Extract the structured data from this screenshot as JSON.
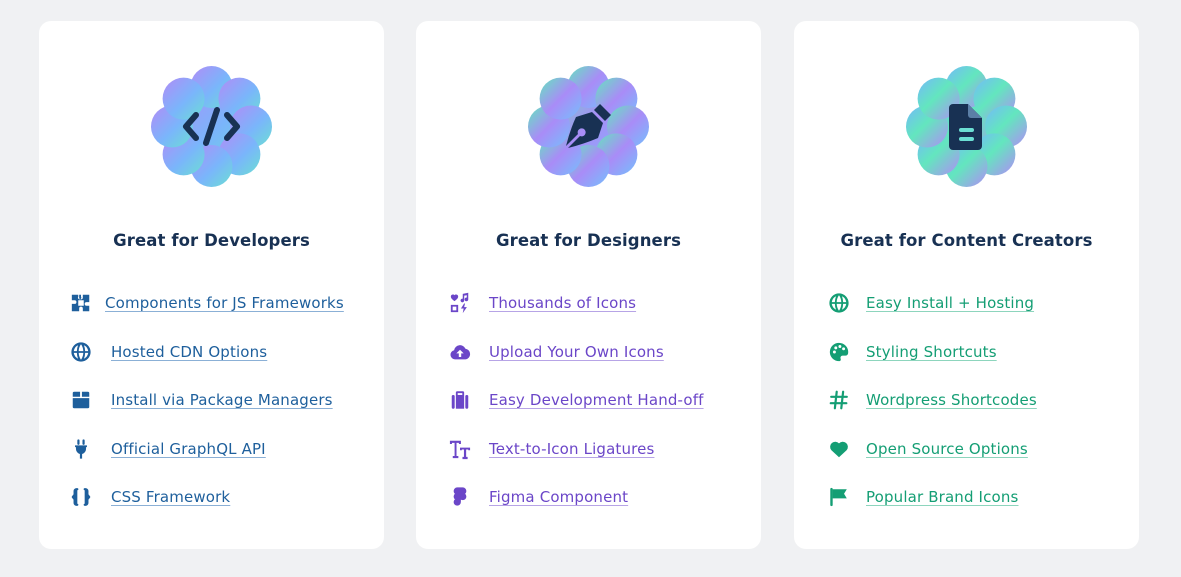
{
  "cards": [
    {
      "title": "Great for Developers",
      "badge_icon": "code-icon",
      "accent": "#1e5f9c",
      "features": [
        {
          "label": "Components for JS Frameworks",
          "icon": "puzzle-pieces-icon"
        },
        {
          "label": "Hosted CDN Options",
          "icon": "globe-icon"
        },
        {
          "label": "Install via Package Managers",
          "icon": "box-icon"
        },
        {
          "label": "Official GraphQL API",
          "icon": "plug-icon"
        },
        {
          "label": "CSS Framework",
          "icon": "curly-braces-icon"
        }
      ]
    },
    {
      "title": "Great for Designers",
      "badge_icon": "pen-nib-icon",
      "accent": "#6b46c8",
      "features": [
        {
          "label": "Thousands of Icons",
          "icon": "icons-collection-icon"
        },
        {
          "label": "Upload Your Own Icons",
          "icon": "cloud-upload-icon"
        },
        {
          "label": "Easy Development Hand-off",
          "icon": "suitcase-icon"
        },
        {
          "label": "Text-to-Icon Ligatures",
          "icon": "text-size-icon"
        },
        {
          "label": "Figma Component",
          "icon": "figma-icon"
        }
      ]
    },
    {
      "title": "Great for Content Creators",
      "badge_icon": "file-lines-icon",
      "accent": "#149e74",
      "features": [
        {
          "label": "Easy Install + Hosting",
          "icon": "globe-icon"
        },
        {
          "label": "Styling Shortcuts",
          "icon": "palette-icon"
        },
        {
          "label": "Wordpress Shortcodes",
          "icon": "hashtag-icon"
        },
        {
          "label": "Open Source Options",
          "icon": "heart-icon"
        },
        {
          "label": "Popular Brand Icons",
          "icon": "flag-icon"
        }
      ]
    }
  ],
  "colors": {
    "background": "#f0f1f3",
    "card": "#ffffff",
    "title": "#183153",
    "badge_gradient": [
      "#a78bfa",
      "#74b9fb",
      "#63e6be"
    ]
  }
}
